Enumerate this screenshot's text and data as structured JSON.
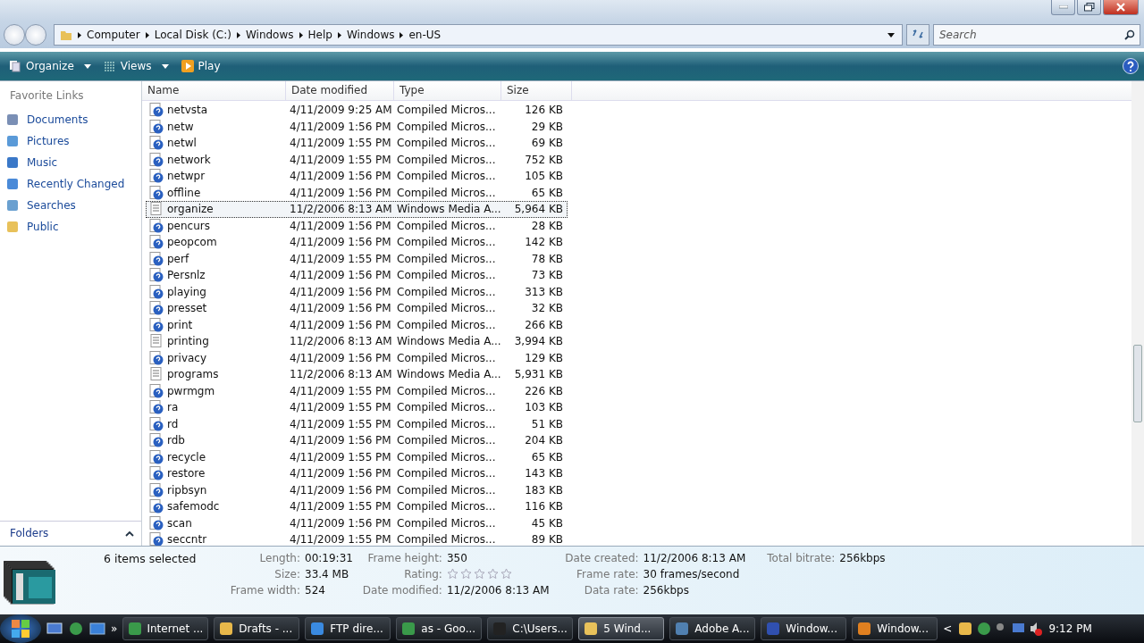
{
  "address": {
    "crumbs": [
      "Computer",
      "Local Disk (C:)",
      "Windows",
      "Help",
      "Windows",
      "en-US"
    ]
  },
  "search": {
    "placeholder": "Search"
  },
  "toolbar": [
    {
      "label": "Organize",
      "kind": "menu"
    },
    {
      "label": "Views",
      "kind": "views"
    },
    {
      "label": "Play",
      "kind": "play"
    }
  ],
  "sidebar": {
    "title": "Favorite Links",
    "items": [
      {
        "label": "Documents",
        "kind": "docs"
      },
      {
        "label": "Pictures",
        "kind": "pics"
      },
      {
        "label": "Music",
        "kind": "music"
      },
      {
        "label": "Recently Changed",
        "kind": "recent"
      },
      {
        "label": "Searches",
        "kind": "search"
      },
      {
        "label": "Public",
        "kind": "folder"
      }
    ],
    "folders": "Folders"
  },
  "table": {
    "columns": [
      "Name",
      "Date modified",
      "Type",
      "Size"
    ],
    "rows": [
      {
        "name": "netvsta",
        "date": "4/11/2009 9:25 AM",
        "type": "Compiled Micros...",
        "size": "126 KB",
        "kind": "help",
        "selected": false
      },
      {
        "name": "netw",
        "date": "4/11/2009 1:56 PM",
        "type": "Compiled Micros...",
        "size": "29 KB",
        "kind": "help",
        "selected": false
      },
      {
        "name": "netwl",
        "date": "4/11/2009 1:55 PM",
        "type": "Compiled Micros...",
        "size": "69 KB",
        "kind": "help",
        "selected": false
      },
      {
        "name": "network",
        "date": "4/11/2009 1:55 PM",
        "type": "Compiled Micros...",
        "size": "752 KB",
        "kind": "help",
        "selected": false
      },
      {
        "name": "netwpr",
        "date": "4/11/2009 1:56 PM",
        "type": "Compiled Micros...",
        "size": "105 KB",
        "kind": "help",
        "selected": false
      },
      {
        "name": "offline",
        "date": "4/11/2009 1:56 PM",
        "type": "Compiled Micros...",
        "size": "65 KB",
        "kind": "help",
        "selected": false
      },
      {
        "name": "organize",
        "date": "11/2/2006 8:13 AM",
        "type": "Windows Media A...",
        "size": "5,964 KB",
        "kind": "media",
        "selected": true
      },
      {
        "name": "pencurs",
        "date": "4/11/2009 1:56 PM",
        "type": "Compiled Micros...",
        "size": "28 KB",
        "kind": "help",
        "selected": false
      },
      {
        "name": "peopcom",
        "date": "4/11/2009 1:56 PM",
        "type": "Compiled Micros...",
        "size": "142 KB",
        "kind": "help",
        "selected": false
      },
      {
        "name": "perf",
        "date": "4/11/2009 1:55 PM",
        "type": "Compiled Micros...",
        "size": "78 KB",
        "kind": "help",
        "selected": false
      },
      {
        "name": "Persnlz",
        "date": "4/11/2009 1:56 PM",
        "type": "Compiled Micros...",
        "size": "73 KB",
        "kind": "help",
        "selected": false
      },
      {
        "name": "playing",
        "date": "4/11/2009 1:56 PM",
        "type": "Compiled Micros...",
        "size": "313 KB",
        "kind": "help",
        "selected": false
      },
      {
        "name": "presset",
        "date": "4/11/2009 1:56 PM",
        "type": "Compiled Micros...",
        "size": "32 KB",
        "kind": "help",
        "selected": false
      },
      {
        "name": "print",
        "date": "4/11/2009 1:56 PM",
        "type": "Compiled Micros...",
        "size": "266 KB",
        "kind": "help",
        "selected": false
      },
      {
        "name": "printing",
        "date": "11/2/2006 8:13 AM",
        "type": "Windows Media A...",
        "size": "3,994 KB",
        "kind": "media",
        "selected": false
      },
      {
        "name": "privacy",
        "date": "4/11/2009 1:56 PM",
        "type": "Compiled Micros...",
        "size": "129 KB",
        "kind": "help",
        "selected": false
      },
      {
        "name": "programs",
        "date": "11/2/2006 8:13 AM",
        "type": "Windows Media A...",
        "size": "5,931 KB",
        "kind": "media",
        "selected": false
      },
      {
        "name": "pwrmgm",
        "date": "4/11/2009 1:55 PM",
        "type": "Compiled Micros...",
        "size": "226 KB",
        "kind": "help",
        "selected": false
      },
      {
        "name": "ra",
        "date": "4/11/2009 1:55 PM",
        "type": "Compiled Micros...",
        "size": "103 KB",
        "kind": "help",
        "selected": false
      },
      {
        "name": "rd",
        "date": "4/11/2009 1:55 PM",
        "type": "Compiled Micros...",
        "size": "51 KB",
        "kind": "help",
        "selected": false
      },
      {
        "name": "rdb",
        "date": "4/11/2009 1:56 PM",
        "type": "Compiled Micros...",
        "size": "204 KB",
        "kind": "help",
        "selected": false
      },
      {
        "name": "recycle",
        "date": "4/11/2009 1:55 PM",
        "type": "Compiled Micros...",
        "size": "65 KB",
        "kind": "help",
        "selected": false
      },
      {
        "name": "restore",
        "date": "4/11/2009 1:56 PM",
        "type": "Compiled Micros...",
        "size": "143 KB",
        "kind": "help",
        "selected": false
      },
      {
        "name": "ripbsyn",
        "date": "4/11/2009 1:56 PM",
        "type": "Compiled Micros...",
        "size": "183 KB",
        "kind": "help",
        "selected": false
      },
      {
        "name": "safemodc",
        "date": "4/11/2009 1:55 PM",
        "type": "Compiled Micros...",
        "size": "116 KB",
        "kind": "help",
        "selected": false
      },
      {
        "name": "scan",
        "date": "4/11/2009 1:56 PM",
        "type": "Compiled Micros...",
        "size": "45 KB",
        "kind": "help",
        "selected": false
      },
      {
        "name": "seccntr",
        "date": "4/11/2009 1:55 PM",
        "type": "Compiled Micros...",
        "size": "89 KB",
        "kind": "help",
        "selected": false
      }
    ]
  },
  "details": {
    "summary": "6 items selected",
    "stars": 0,
    "columns": [
      [
        {
          "label": "Length:",
          "value": "00:19:31"
        },
        {
          "label": "Size:",
          "value": "33.4 MB"
        },
        {
          "label": "Frame width:",
          "value": "524"
        }
      ],
      [
        {
          "label": "Frame height:",
          "value": "350"
        },
        {
          "label": "Rating:",
          "kind": "rating"
        },
        {
          "label": "Date modified:",
          "value": "11/2/2006 8:13 AM"
        }
      ],
      [
        {
          "label": "Date created:",
          "value": "11/2/2006 8:13 AM"
        },
        {
          "label": "Frame rate:",
          "value": "30 frames/second"
        },
        {
          "label": "Data rate:",
          "value": "256kbps"
        }
      ],
      [
        {
          "label": "Total bitrate:",
          "value": "256kbps"
        }
      ]
    ]
  },
  "taskbar": {
    "quick_more": "»",
    "items": [
      {
        "label": "Internet ...",
        "kind": "globe",
        "selected": false
      },
      {
        "label": "Drafts - ...",
        "kind": "mail",
        "selected": false
      },
      {
        "label": "FTP dire...",
        "kind": "ie",
        "selected": false
      },
      {
        "label": "as - Goo...",
        "kind": "globe",
        "selected": false
      },
      {
        "label": "C:\\Users...",
        "kind": "cmd",
        "selected": false
      },
      {
        "label": "5 Wind...",
        "kind": "folder",
        "selected": true
      },
      {
        "label": "Adobe A...",
        "kind": "app",
        "selected": false
      },
      {
        "label": "Window...",
        "kind": "help",
        "selected": false
      },
      {
        "label": "Window...",
        "kind": "play",
        "selected": false
      }
    ],
    "tray_more": "<",
    "clock": "9:12 PM"
  }
}
